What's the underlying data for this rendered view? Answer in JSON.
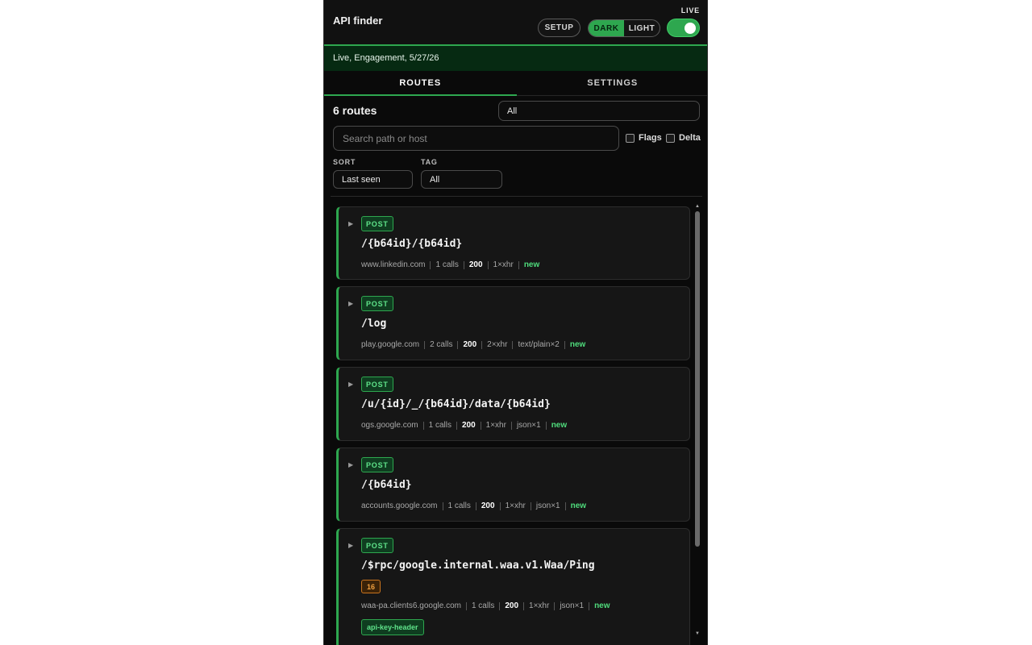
{
  "header": {
    "title": "API finder",
    "setup_label": "SETUP",
    "theme_dark_label": "DARK",
    "theme_light_label": "LIGHT",
    "live_label": "LIVE",
    "live_on": true
  },
  "status": {
    "text": "Live, Engagement, 5/27/26"
  },
  "tabs": [
    {
      "label": "ROUTES",
      "active": true
    },
    {
      "label": "SETTINGS",
      "active": false
    }
  ],
  "filters": {
    "route_count": "6 routes",
    "top_select_value": "All",
    "search_placeholder": "Search path or host",
    "flags_label": "Flags",
    "delta_label": "Delta",
    "sort_label": "SORT",
    "sort_value": "Last seen",
    "tag_label": "TAG",
    "tag_value": "All"
  },
  "routes": [
    {
      "method": "POST",
      "path": "/{b64id}/{b64id}",
      "host": "www.linkedin.com",
      "calls": "1 calls",
      "status": "200",
      "xhr": "1×xhr",
      "ctype": "",
      "flag": "new"
    },
    {
      "method": "POST",
      "path": "/log",
      "host": "play.google.com",
      "calls": "2 calls",
      "status": "200",
      "xhr": "2×xhr",
      "ctype": "text/plain×2",
      "flag": "new"
    },
    {
      "method": "POST",
      "path": "/u/{id}/_/{b64id}/data/{b64id}",
      "host": "ogs.google.com",
      "calls": "1 calls",
      "status": "200",
      "xhr": "1×xhr",
      "ctype": "json×1",
      "flag": "new"
    },
    {
      "method": "POST",
      "path": "/{b64id}",
      "host": "accounts.google.com",
      "calls": "1 calls",
      "status": "200",
      "xhr": "1×xhr",
      "ctype": "json×1",
      "flag": "new"
    },
    {
      "method": "POST",
      "path": "/$rpc/google.internal.waa.v1.Waa/Ping",
      "count_badge": "16",
      "host": "waa-pa.clients6.google.com",
      "calls": "1 calls",
      "status": "200",
      "xhr": "1×xhr",
      "ctype": "json×1",
      "flag": "new",
      "tag": "api-key-header"
    }
  ],
  "colors": {
    "accent": "#2ea74f",
    "background": "#0a0a0a",
    "card": "#161616",
    "warning": "#c9741e"
  }
}
